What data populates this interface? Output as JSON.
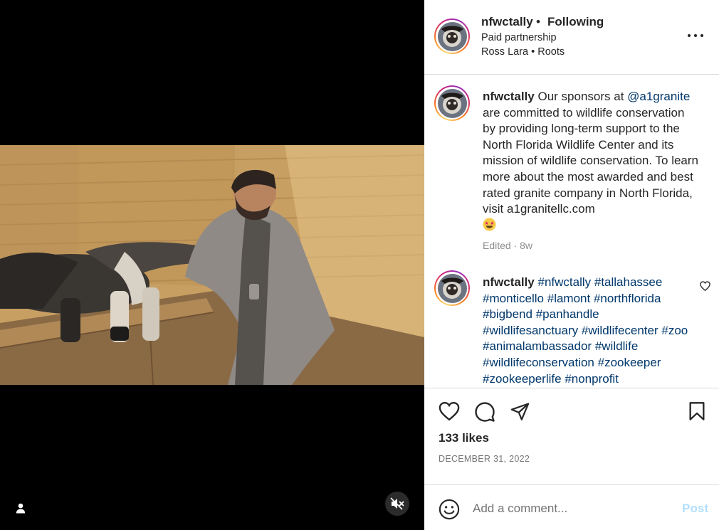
{
  "post": {
    "username": "nfwctally",
    "follow_separator": "•",
    "follow_status": "Following",
    "paid_partnership": "Paid partnership",
    "audio_artist": "Ross Lara",
    "audio_separator": " • ",
    "audio_track": "Roots"
  },
  "caption": {
    "username": "nfwctally",
    "text_before_mention": " Our sponsors at ",
    "mention": "@a1granite",
    "text_after_mention": " are committed to wildlife conservation by providing long-term support to the North Florida Wildlife Center and its mission of wildlife conservation. To learn more about the most awarded and best rated granite company in North Florida, visit a1granitellc.com",
    "emoji": "star-struck-emoji",
    "meta": "Edited · 8w"
  },
  "hashtag_comment": {
    "username": "nfwctally",
    "hashtags": [
      "#nfwctally",
      "#tallahassee",
      "#monticello",
      "#lamont",
      "#northflorida",
      "#bigbend",
      "#panhandle",
      "#wildlifesanctuary",
      "#wildlifecenter",
      "#zoo",
      "#animalambassador",
      "#wildlife",
      "#wildlifeconservation",
      "#zookeeper",
      "#zookeeperlife",
      "#nonprofit"
    ]
  },
  "actions": {
    "likes": "133 likes",
    "date": "DECEMBER 31, 2022"
  },
  "comment_box": {
    "placeholder": "Add a comment...",
    "post_label": "Post"
  },
  "colors": {
    "link": "#00376b",
    "post_disabled": "#b2dffc",
    "divider": "#dbdbdb",
    "muted": "#8e8e8e"
  },
  "icons": [
    "user-tag-icon",
    "muted-speaker-icon",
    "more-options-icon",
    "heart-icon",
    "comment-icon",
    "share-icon",
    "bookmark-icon",
    "emoji-icon"
  ]
}
